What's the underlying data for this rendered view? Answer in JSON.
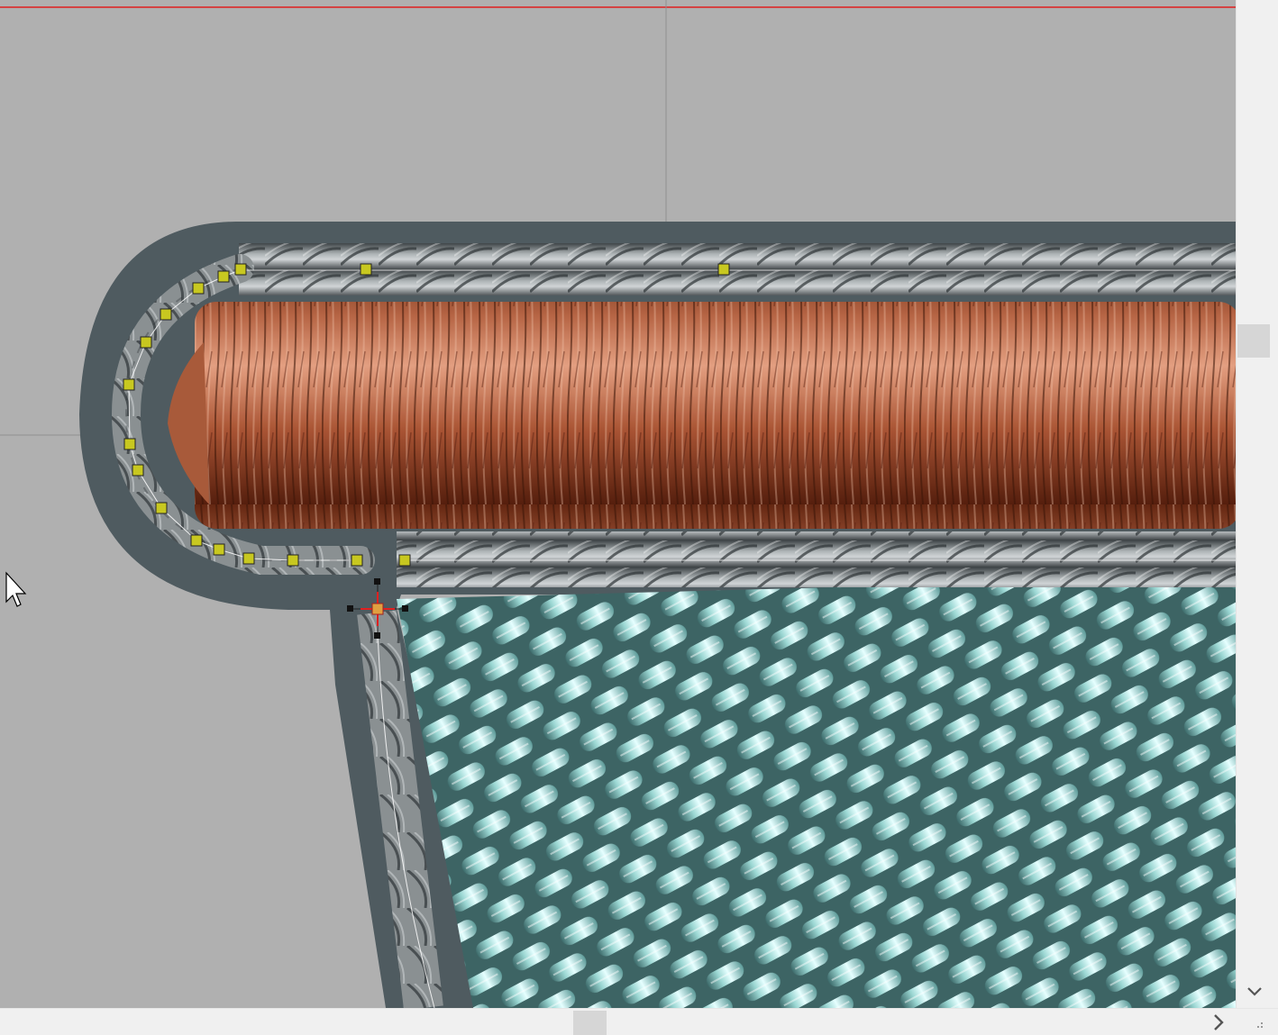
{
  "canvas": {
    "background_color": "#b0b0b0",
    "backing_color": "#4f5b60",
    "satin_color": "#b8653e",
    "fill_color": "#9fd4d0",
    "outline_color": "#7a7f82",
    "node_color": "#c8c820",
    "frame_line_color": "#e02020"
  },
  "icons": {
    "cursor": "mouse-pointer-icon",
    "anchor": "crosshair-anchor-icon",
    "scroll_down": "chevron-down-icon",
    "scroll_right": "chevron-right-icon",
    "resize_grip": "resize-grip-icon"
  }
}
